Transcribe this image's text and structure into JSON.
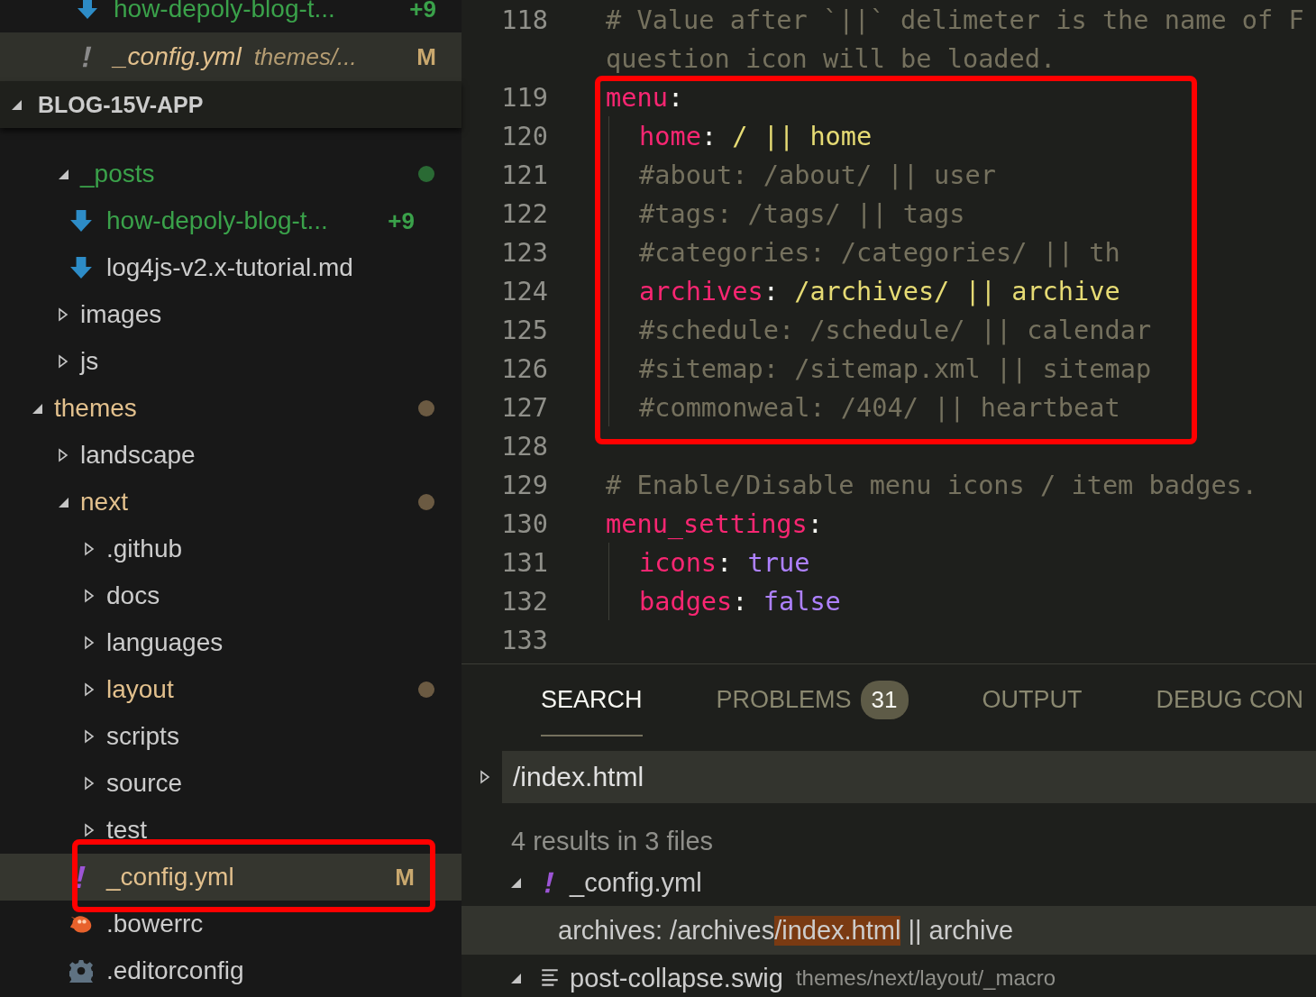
{
  "sidebar": {
    "open_editors": [
      {
        "name": "how-depoly-blog-t...",
        "decoration": "+9",
        "added": true,
        "modified": false,
        "kind": "markdown",
        "preview": false,
        "selected": false
      },
      {
        "name": "_config.yml",
        "description": "themes/...",
        "decoration": "M",
        "added": false,
        "modified": true,
        "kind": "yaml",
        "preview": true,
        "selected": true
      }
    ],
    "section": {
      "title": "BLOG-15V-APP",
      "expanded": true
    },
    "tree": [
      {
        "kind": "scrolled_off",
        "children": [
          {
            "kind": "folder",
            "name": "_posts",
            "expanded": true,
            "added": true,
            "modified": false,
            "color": "#2a6a34",
            "children": [
              {
                "kind": "markdown",
                "name": "how-depoly-blog-t...",
                "added": true,
                "modified": false,
                "decoration": "+9"
              },
              {
                "kind": "markdown",
                "name": "log4js-v2.x-tutorial.md",
                "added": false,
                "modified": false
              }
            ]
          },
          {
            "kind": "folder",
            "name": "images",
            "expanded": false,
            "added": false,
            "modified": false
          },
          {
            "kind": "folder",
            "name": "js",
            "expanded": false,
            "added": false,
            "modified": false
          }
        ]
      },
      {
        "kind": "folder",
        "name": "themes",
        "expanded": true,
        "added": false,
        "modified": true,
        "color": "#6b5a42",
        "children": [
          {
            "kind": "folder",
            "name": "landscape",
            "expanded": false,
            "added": false,
            "modified": false
          },
          {
            "kind": "folder",
            "name": "next",
            "expanded": true,
            "added": false,
            "modified": true,
            "color": "#6b5a42",
            "children": [
              {
                "kind": "folder",
                "name": ".github",
                "expanded": false,
                "added": false,
                "modified": false
              },
              {
                "kind": "folder",
                "name": "docs",
                "expanded": false,
                "added": false,
                "modified": false
              },
              {
                "kind": "folder",
                "name": "languages",
                "expanded": false,
                "added": false,
                "modified": false
              },
              {
                "kind": "folder",
                "name": "layout",
                "expanded": false,
                "added": false,
                "modified": true,
                "color": "#6b5a42"
              },
              {
                "kind": "folder",
                "name": "scripts",
                "expanded": false,
                "added": false,
                "modified": false
              },
              {
                "kind": "folder",
                "name": "source",
                "expanded": false,
                "added": false,
                "modified": false
              },
              {
                "kind": "folder",
                "name": "test",
                "expanded": false,
                "added": false,
                "modified": false
              },
              {
                "kind": "yaml",
                "name": "_config.yml",
                "added": false,
                "modified": true,
                "decoration": "M",
                "selected": true,
                "highlighted": true
              },
              {
                "kind": "bower",
                "name": ".bowerrc",
                "added": false,
                "modified": false
              },
              {
                "kind": "config",
                "name": ".editorconfig",
                "added": false,
                "modified": false
              }
            ]
          }
        ]
      }
    ]
  },
  "editor": {
    "lines": [
      {
        "number": "118",
        "tokens": [
          {
            "kind": "comment",
            "text": "# Value after `||` delimeter is the name of F"
          }
        ],
        "continuation": "question icon will be loaded."
      },
      {
        "number": "119",
        "highlighted": true,
        "tokens": [
          {
            "kind": "key",
            "text": "menu"
          },
          {
            "kind": "punct",
            "text": ":"
          }
        ],
        "children": [
          {
            "number": "120",
            "tokens": [
              {
                "kind": "key",
                "text": "home"
              },
              {
                "kind": "punct",
                "text": ": "
              },
              {
                "kind": "string",
                "text": "/ || home"
              }
            ]
          },
          {
            "number": "121",
            "tokens": [
              {
                "kind": "comment",
                "text": "#about: /about/ || user"
              }
            ]
          },
          {
            "number": "122",
            "tokens": [
              {
                "kind": "comment",
                "text": "#tags: /tags/ || tags"
              }
            ]
          },
          {
            "number": "123",
            "tokens": [
              {
                "kind": "comment",
                "text": "#categories: /categories/ || th"
              }
            ]
          },
          {
            "number": "124",
            "tokens": [
              {
                "kind": "key",
                "text": "archives"
              },
              {
                "kind": "punct",
                "text": ": "
              },
              {
                "kind": "string",
                "text": "/archives/ || archive"
              }
            ]
          },
          {
            "number": "125",
            "tokens": [
              {
                "kind": "comment",
                "text": "#schedule: /schedule/ || calendar"
              }
            ]
          },
          {
            "number": "126",
            "tokens": [
              {
                "kind": "comment",
                "text": "#sitemap: /sitemap.xml || sitemap"
              }
            ]
          },
          {
            "number": "127",
            "tokens": [
              {
                "kind": "comment",
                "text": "#commonweal: /404/ || heartbeat"
              }
            ]
          }
        ]
      },
      {
        "number": "128"
      },
      {
        "number": "129",
        "tokens": [
          {
            "kind": "comment",
            "text": "# Enable/Disable menu icons / item badges."
          }
        ]
      },
      {
        "number": "130",
        "tokens": [
          {
            "kind": "key",
            "text": "menu_settings"
          },
          {
            "kind": "punct",
            "text": ":"
          }
        ],
        "children": [
          {
            "number": "131",
            "tokens": [
              {
                "kind": "key",
                "text": "icons"
              },
              {
                "kind": "punct",
                "text": ": "
              },
              {
                "kind": "bool",
                "text": "true"
              }
            ]
          },
          {
            "number": "132",
            "tokens": [
              {
                "kind": "key",
                "text": "badges"
              },
              {
                "kind": "punct",
                "text": ": "
              },
              {
                "kind": "bool",
                "text": "false"
              }
            ]
          }
        ]
      },
      {
        "number": "133"
      }
    ]
  },
  "panel": {
    "tabs": [
      {
        "label": "SEARCH",
        "selected": true
      },
      {
        "label": "PROBLEMS",
        "badge": "31",
        "selected": false
      },
      {
        "label": "OUTPUT",
        "selected": false
      },
      {
        "label": "DEBUG CON",
        "selected": false
      }
    ],
    "search": {
      "value": "/index.html",
      "replace_expanded": false
    },
    "summary": "4 results in 3 files",
    "results": [
      {
        "file": "_config.yml",
        "kind": "yaml",
        "expanded": true,
        "matches": [
          {
            "before": "archives: /archives",
            "match": "/index.html",
            "after": " || archive",
            "selected": true
          }
        ]
      },
      {
        "file": "post-collapse.swig",
        "description": "themes/next/layout/_macro",
        "kind": "swig",
        "expanded": true
      }
    ]
  }
}
